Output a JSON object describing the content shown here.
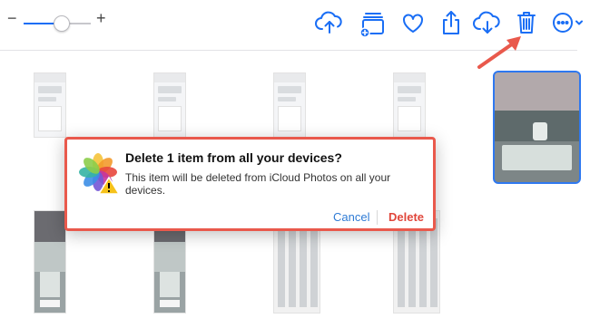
{
  "toolbar": {
    "zoom_minus": "−",
    "zoom_plus": "+",
    "zoom_level": 0.55,
    "icons": [
      "upload-cloud-icon",
      "add-to-album-icon",
      "favorite-heart-icon",
      "share-icon",
      "download-cloud-icon",
      "trash-icon",
      "more-options-icon"
    ]
  },
  "colors": {
    "accent": "#1a6ef5",
    "annotation": "#e9594c",
    "destructive": "#e0463b",
    "link": "#2f7bd5"
  },
  "dialog": {
    "title": "Delete 1 item from all your devices?",
    "message": "This item will be deleted from iCloud Photos on all your devices.",
    "cancel_label": "Cancel",
    "delete_label": "Delete",
    "icon": "photos-app-warning-icon"
  },
  "grid": {
    "selected_count": 1
  }
}
